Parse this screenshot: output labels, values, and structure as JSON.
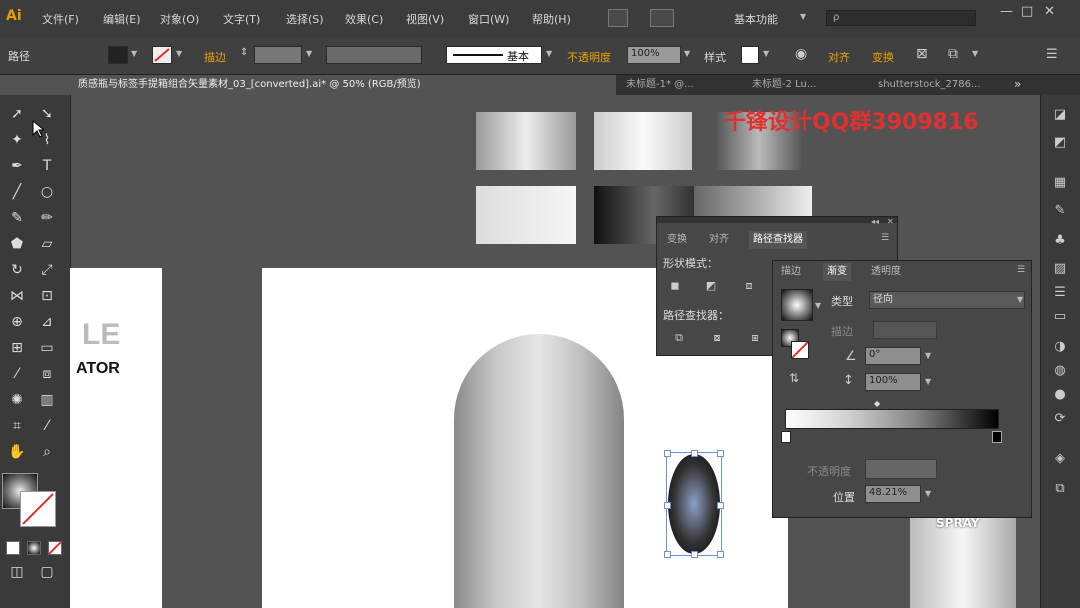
{
  "app": {
    "logo": "Ai"
  },
  "menu": [
    "文件(F)",
    "编辑(E)",
    "对象(O)",
    "文字(T)",
    "选择(S)",
    "效果(C)",
    "视图(V)",
    "窗口(W)",
    "帮助(H)"
  ],
  "workspace": "基本功能",
  "search": {
    "placeholder": "ρ"
  },
  "window_controls": {
    "minimize": "—",
    "restore": "□",
    "close": "✕"
  },
  "control": {
    "object_label": "路径",
    "stroke_label": "描边",
    "style_basic": "基本",
    "opacity_label": "不透明度",
    "opacity_value": "100%",
    "style_label": "样式",
    "link1": "对齐",
    "link2": "变换"
  },
  "tabs": [
    "质感瓶与标签手提箱组合矢量素材_03_[converted].ai* @ 50% (RGB/预览)",
    "未标题-1* @...",
    "未标题-2 Lu...",
    "shutterstock_2786..."
  ],
  "tabs_more": "»",
  "watermark": "千锋设计QQ群3909816",
  "canvas": {
    "partial_text_1": "LE",
    "partial_text_2": "ATOR",
    "label_right": "SPRAY"
  },
  "pathfinder": {
    "tabs": [
      "变换",
      "对齐",
      "路径查找器"
    ],
    "shape_modes": "形状模式：",
    "pathfinders": "路径查找器："
  },
  "gradient": {
    "tabs": [
      "描边",
      "渐变",
      "透明度"
    ],
    "type_label": "类型",
    "type_value": "径向",
    "stroke_label": "描边",
    "angle_value": "0°",
    "aspect_value": "100%",
    "opacity_label": "不透明度",
    "location_label": "位置",
    "location_value": "48.21%"
  },
  "colors": {
    "accent": "#e03030",
    "highlight": "#e8a000",
    "panel": "#474747",
    "ui": "#3c3c3c"
  }
}
